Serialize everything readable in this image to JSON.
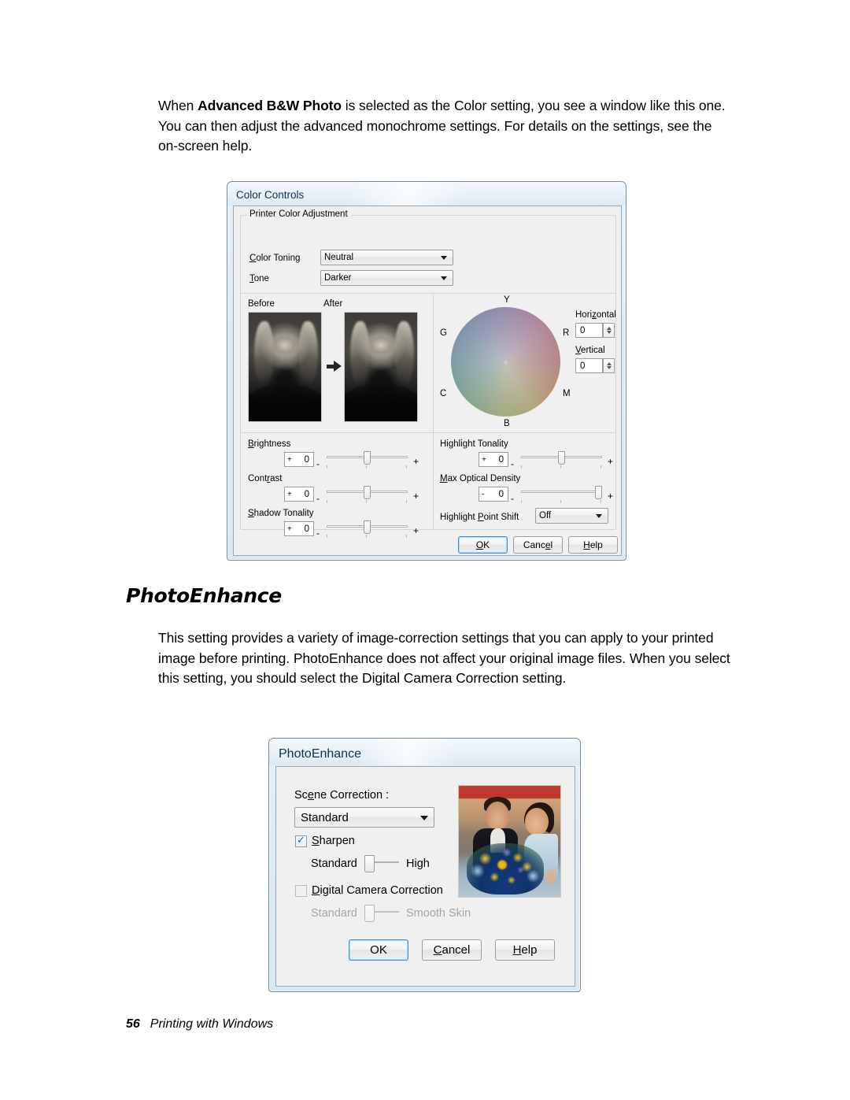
{
  "page": {
    "intro_paragraph_parts": {
      "p1": "When ",
      "bold": "Advanced B&W Photo",
      "p2": " is selected as the Color setting, you see a window like this one. You can then adjust the advanced monochrome settings. For details on the settings, see the on-screen help."
    },
    "section_heading": "PhotoEnhance",
    "section_paragraph": "This setting provides a variety of image-correction settings that you can apply to your printed image before printing. PhotoEnhance does not affect your original image files. When you select this setting, you should select the Digital Camera Correction setting.",
    "footer_page_number": "56",
    "footer_text": "Printing with Windows"
  },
  "color_controls_dialog": {
    "title": "Color Controls",
    "group_caption": "Printer Color Adjustment",
    "fields": {
      "color_toning_label": "Color Toning",
      "color_toning_value": "Neutral",
      "tone_label": "Tone",
      "tone_value": "Darker"
    },
    "preview": {
      "before_label": "Before",
      "after_label": "After"
    },
    "color_wheel": {
      "top_label": "Y",
      "right_label": "R",
      "bottom_label": "B",
      "left_label": "G",
      "lower_left_label": "C",
      "lower_right_label": "M",
      "horizontal_label": "Horizontal",
      "horizontal_value": "0",
      "vertical_label": "Vertical",
      "vertical_value": "0"
    },
    "sliders_left": [
      {
        "label": "Brightness",
        "sign": "+",
        "value": "0",
        "minus": "-",
        "plus": "+"
      },
      {
        "label": "Contrast",
        "sign": "+",
        "value": "0",
        "minus": "-",
        "plus": "+"
      },
      {
        "label": "Shadow Tonality",
        "sign": "+",
        "value": "0",
        "minus": "-",
        "plus": "+"
      }
    ],
    "sliders_right": [
      {
        "label": "Highlight Tonality",
        "sign": "+",
        "value": "0",
        "minus": "-",
        "plus": "+"
      },
      {
        "label": "Max Optical Density",
        "sign": "-",
        "value": "0",
        "minus": "-",
        "plus": "+"
      }
    ],
    "highlight_point_shift_label": "Highlight Point Shift",
    "highlight_point_shift_value": "Off",
    "buttons": {
      "ok": "OK",
      "cancel": "Cancel",
      "help": "Help"
    }
  },
  "photoenhance_dialog": {
    "title": "PhotoEnhance",
    "scene_correction_label": "Scene Correction :",
    "scene_correction_value": "Standard",
    "sharpen_label": "Sharpen",
    "sharpen_checked": true,
    "sharpen_min_label": "Standard",
    "sharpen_max_label": "High",
    "digital_camera_correction_label": "Digital Camera Correction",
    "digital_camera_correction_checked": false,
    "dcc_min_label": "Standard",
    "dcc_max_label": "Smooth Skin",
    "buttons": {
      "ok": "OK",
      "cancel": "Cancel",
      "help": "Help"
    }
  }
}
